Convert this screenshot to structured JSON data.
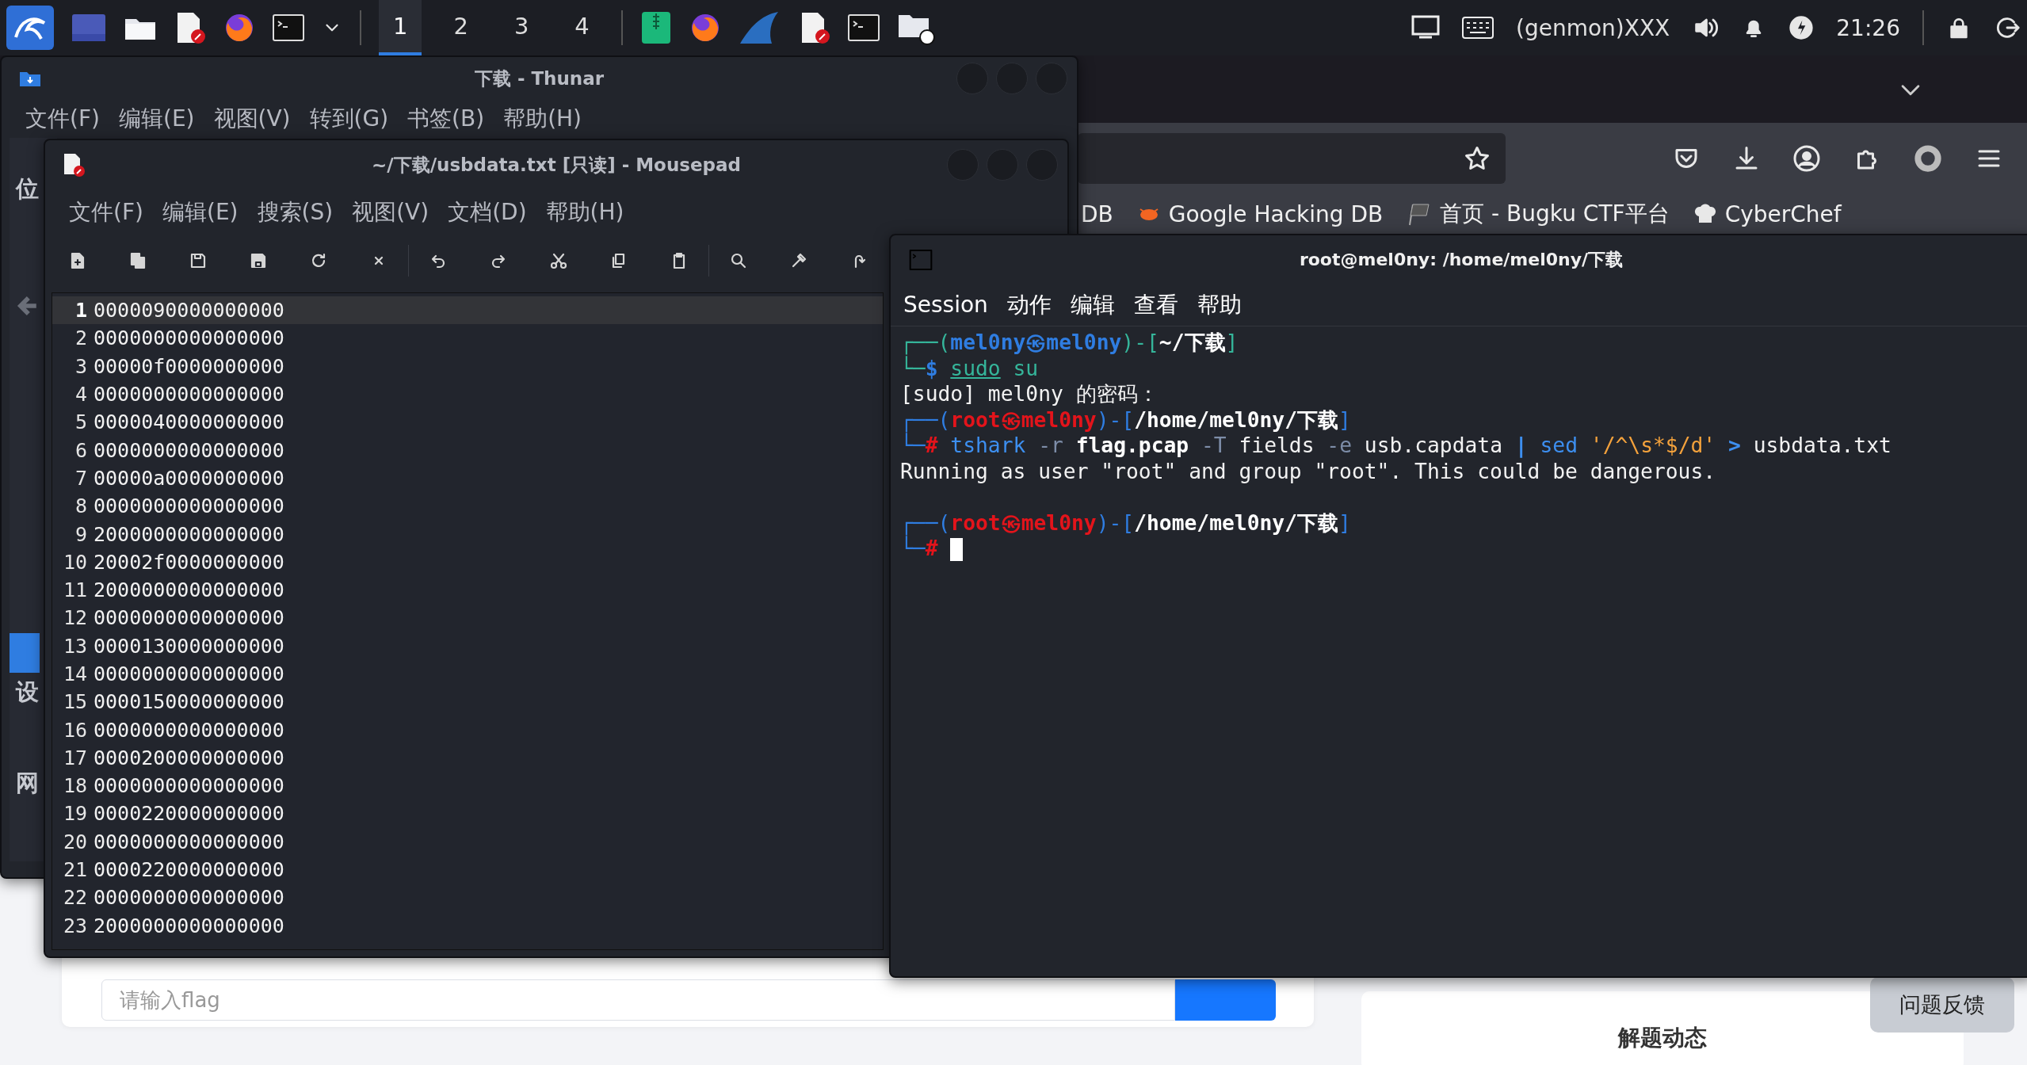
{
  "taskbar": {
    "workspaces": [
      {
        "label": "1",
        "selected": true
      },
      {
        "label": "2",
        "selected": false
      },
      {
        "label": "3",
        "selected": false
      },
      {
        "label": "4",
        "selected": false
      }
    ],
    "genmon": "(genmon)XXX",
    "clock": "21:26"
  },
  "browser": {
    "bookmarks": [
      {
        "label": "DB",
        "kind": "cut"
      },
      {
        "label": "Google Hacking DB",
        "kind": "bug"
      },
      {
        "label": "首页 - Bugku CTF平台",
        "kind": "flag"
      },
      {
        "label": "CyberChef",
        "kind": "chef"
      }
    ],
    "page": {
      "flag_input": {
        "placeholder": "请输入flag"
      },
      "feedback_button": "问题反馈",
      "side_card_title": "解题动态"
    }
  },
  "thunar": {
    "title": "下载 - Thunar",
    "menu": [
      "文件(F)",
      "编辑(E)",
      "视图(V)",
      "转到(G)",
      "书签(B)",
      "帮助(H)"
    ],
    "sidebar_headings": [
      "位",
      "设",
      "网"
    ]
  },
  "mousepad": {
    "title": "~/下载/usbdata.txt [只读] - Mousepad",
    "menu": [
      "文件(F)",
      "编辑(E)",
      "搜索(S)",
      "视图(V)",
      "文档(D)",
      "帮助(H)"
    ],
    "lines": [
      {
        "number": "1",
        "text": "0000090000000000",
        "current": true
      },
      {
        "number": "2",
        "text": "0000000000000000",
        "current": false
      },
      {
        "number": "3",
        "text": "00000f0000000000",
        "current": false
      },
      {
        "number": "4",
        "text": "0000000000000000",
        "current": false
      },
      {
        "number": "5",
        "text": "0000040000000000",
        "current": false
      },
      {
        "number": "6",
        "text": "0000000000000000",
        "current": false
      },
      {
        "number": "7",
        "text": "00000a0000000000",
        "current": false
      },
      {
        "number": "8",
        "text": "0000000000000000",
        "current": false
      },
      {
        "number": "9",
        "text": "2000000000000000",
        "current": false
      },
      {
        "number": "10",
        "text": "20002f0000000000",
        "current": false
      },
      {
        "number": "11",
        "text": "2000000000000000",
        "current": false
      },
      {
        "number": "12",
        "text": "0000000000000000",
        "current": false
      },
      {
        "number": "13",
        "text": "0000130000000000",
        "current": false
      },
      {
        "number": "14",
        "text": "0000000000000000",
        "current": false
      },
      {
        "number": "15",
        "text": "0000150000000000",
        "current": false
      },
      {
        "number": "16",
        "text": "0000000000000000",
        "current": false
      },
      {
        "number": "17",
        "text": "0000200000000000",
        "current": false
      },
      {
        "number": "18",
        "text": "0000000000000000",
        "current": false
      },
      {
        "number": "19",
        "text": "0000220000000000",
        "current": false
      },
      {
        "number": "20",
        "text": "0000000000000000",
        "current": false
      },
      {
        "number": "21",
        "text": "0000220000000000",
        "current": false
      },
      {
        "number": "22",
        "text": "0000000000000000",
        "current": false
      },
      {
        "number": "23",
        "text": "2000000000000000",
        "current": false
      }
    ]
  },
  "terminal": {
    "title": "root@mel0ny: /home/mel0ny/下载",
    "menu": [
      "Session",
      "动作",
      "编辑",
      "查看",
      "帮助"
    ],
    "lines": [
      [
        {
          "text": "┌──(",
          "kind": "frame_user"
        },
        {
          "text": "mel0ny㉿mel0ny",
          "kind": "name_user"
        },
        {
          "text": ")-[",
          "kind": "frame_user"
        },
        {
          "text": "~/下载",
          "kind": "path"
        },
        {
          "text": "]",
          "kind": "frame_user"
        }
      ],
      [
        {
          "text": "└─",
          "kind": "frame_user"
        },
        {
          "text": "$ ",
          "kind": "name_user"
        },
        {
          "text": "sudo",
          "kind": "link"
        },
        {
          "text": " su",
          "kind": "ok"
        }
      ],
      [
        {
          "text": "[sudo] mel0ny 的密码：",
          "kind": "plain"
        }
      ],
      [
        {
          "text": "┌──(",
          "kind": "frame_root"
        },
        {
          "text": "root㉿mel0ny",
          "kind": "name_root"
        },
        {
          "text": ")-[",
          "kind": "frame_root"
        },
        {
          "text": "/home/mel0ny/下载",
          "kind": "path"
        },
        {
          "text": "]",
          "kind": "frame_root"
        }
      ],
      [
        {
          "text": "└─",
          "kind": "frame_root"
        },
        {
          "text": "#",
          "kind": "name_root"
        },
        {
          "text": " tshark",
          "kind": "cmd"
        },
        {
          "text": " -r",
          "kind": "opt"
        },
        {
          "text": " flag.pcap",
          "kind": "path"
        },
        {
          "text": " -T",
          "kind": "opt"
        },
        {
          "text": " fields",
          "kind": "plain"
        },
        {
          "text": " -e",
          "kind": "opt"
        },
        {
          "text": " usb.capdata",
          "kind": "plain"
        },
        {
          "text": " |",
          "kind": "op"
        },
        {
          "text": " sed",
          "kind": "cmd"
        },
        {
          "text": " '/^\\s*$/d'",
          "kind": "str"
        },
        {
          "text": " >",
          "kind": "op"
        },
        {
          "text": " usbdata.txt",
          "kind": "plain"
        }
      ],
      [
        {
          "text": "Running as user \"root\" and group \"root\". This could be dangerous.",
          "kind": "plain"
        }
      ],
      [
        {
          "text": "┌──(",
          "kind": "frame_root",
          "blank_before": true
        },
        {
          "text": "root㉿mel0ny",
          "kind": "name_root"
        },
        {
          "text": ")-[",
          "kind": "frame_root"
        },
        {
          "text": "/home/mel0ny/下载",
          "kind": "path"
        },
        {
          "text": "]",
          "kind": "frame_root"
        }
      ],
      [
        {
          "text": "└─",
          "kind": "frame_root"
        },
        {
          "text": "#",
          "kind": "name_root"
        },
        {
          "kind": "cursor"
        }
      ]
    ]
  }
}
